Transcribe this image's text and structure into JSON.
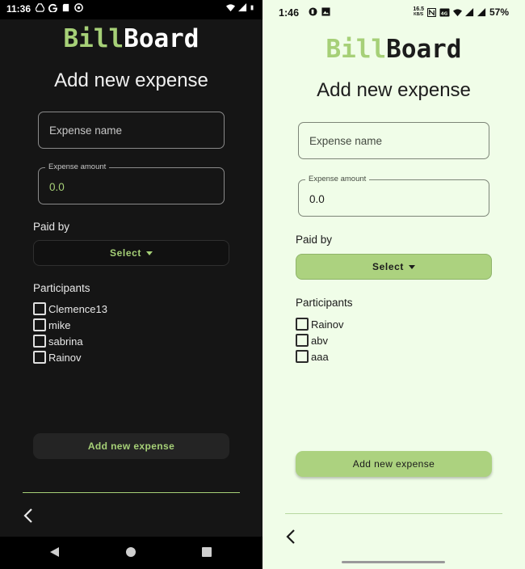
{
  "dark": {
    "status": {
      "time": "11:36"
    },
    "logo": {
      "part1": "Bill",
      "part2": "Board"
    },
    "title": "Add new expense",
    "expense_name": {
      "placeholder": "Expense name"
    },
    "expense_amount": {
      "label": "Expense amount",
      "value": "0.0"
    },
    "paid_by": {
      "label": "Paid by",
      "select_label": "Select"
    },
    "participants": {
      "label": "Participants",
      "items": [
        "Clemence13",
        "mike",
        "sabrina",
        "Rainov"
      ]
    },
    "submit_label": "Add new expense",
    "colors": {
      "background": "#151515",
      "accent": "#a6d077"
    }
  },
  "light": {
    "status": {
      "time": "1:46",
      "net_speed_value": "16.5",
      "net_speed_unit": "KB/S",
      "battery": "57%"
    },
    "logo": {
      "part1": "Bill",
      "part2": "Board"
    },
    "title": "Add new expense",
    "expense_name": {
      "placeholder": "Expense name"
    },
    "expense_amount": {
      "label": "Expense amount",
      "value": "0.0"
    },
    "paid_by": {
      "label": "Paid by",
      "select_label": "Select"
    },
    "participants": {
      "label": "Participants",
      "items": [
        "Rainov",
        "abv",
        "aaa"
      ]
    },
    "submit_label": "Add new expense",
    "colors": {
      "background": "#f0fde8",
      "accent": "#acd27f"
    }
  }
}
